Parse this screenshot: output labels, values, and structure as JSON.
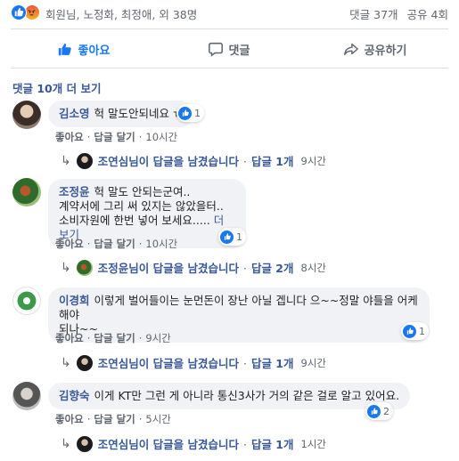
{
  "reactions": {
    "names": "회원님, 노정화, 최정애, 외 38명",
    "comments_count": "댓글 37개",
    "shares_count": "공유 4회",
    "like_color": "#1877f2"
  },
  "actions": {
    "like": "좋아요",
    "comment": "댓글",
    "share": "공유하기"
  },
  "more_comments": "댓글 10개 더 보기",
  "comments": [
    {
      "author": "김소영",
      "text": "헉 말도안되네요 ㅠ",
      "likes": "1",
      "like_label": "좋아요",
      "reply_label": "답글 달기",
      "time": "10시간",
      "reply": {
        "text": "조연심님이 답글을 남겼습니다",
        "count": "답글 1개",
        "time": "9시간"
      }
    },
    {
      "author": "조정윤",
      "text_lines": [
        "헉 말도 안되는군여..",
        "계약서에 그리 써 있지는 않았을터..",
        "소비자원에 한번 넣어 보세요..... "
      ],
      "see_more": "더 보기",
      "likes": "1",
      "like_label": "좋아요",
      "reply_label": "답글 달기",
      "time": "10시간",
      "reply": {
        "text": "조정윤님이 답글을 남겼습니다",
        "count": "답글 2개",
        "time": "8시간"
      }
    },
    {
      "author": "이경희",
      "text_lines": [
        "이렇게 벌어들이는 눈먼돈이 장난 아닐 겝니다 으~~정말 야들을 어케해야",
        "되나~~"
      ],
      "likes": "1",
      "like_label": "좋아요",
      "reply_label": "답글 달기",
      "time": "9시간",
      "reply": {
        "text": "조연심님이 답글을 남겼습니다",
        "count": "답글 1개",
        "time": "9시간"
      }
    },
    {
      "author": "김향숙",
      "text": "이게 KT만 그런 게 아니라 통신3사가 거의 같은 걸로 알고 있어요.",
      "likes": "2",
      "like_label": "좋아요",
      "reply_label": "답글 달기",
      "time": "5시간",
      "reply": {
        "text": "조연심님이 답글을 남겼습니다",
        "count": "답글 1개",
        "time": "1시간"
      }
    }
  ]
}
